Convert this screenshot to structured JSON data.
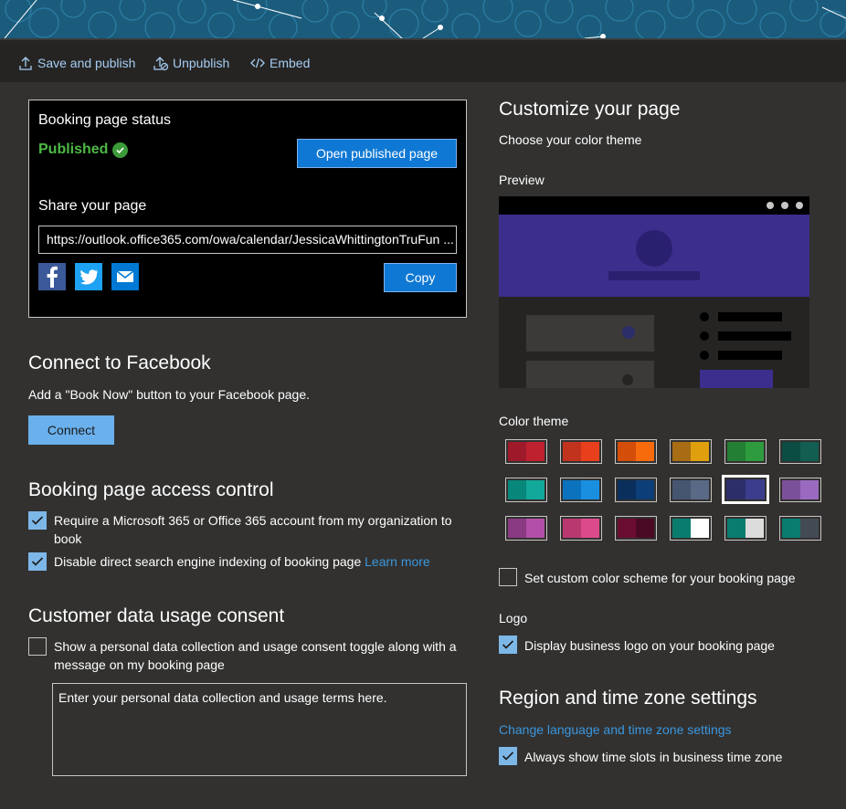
{
  "toolbar": {
    "save": "Save and publish",
    "unpublish": "Unpublish",
    "embed": "Embed"
  },
  "status": {
    "title": "Booking page status",
    "state": "Published",
    "open_button": "Open published page",
    "share_title": "Share your page",
    "url": "https://outlook.office365.com/owa/calendar/JessicaWhittingtonTruFun ...",
    "copy_button": "Copy",
    "social": [
      "facebook-icon",
      "twitter-icon",
      "mail-icon"
    ]
  },
  "facebook": {
    "title": "Connect to Facebook",
    "desc": "Add a \"Book Now\" button to your Facebook page.",
    "button": "Connect"
  },
  "access": {
    "title": "Booking page access control",
    "require_line1": "Require a Microsoft 365 or Office 365 account from my organization to",
    "require_line2": "book",
    "require_checked": true,
    "indexing": "Disable direct search engine indexing of booking page",
    "indexing_checked": true,
    "learn_more": "Learn more"
  },
  "consent": {
    "title": "Customer data usage consent",
    "line1": "Show a personal data collection and usage consent toggle along with a",
    "line2": "message on my booking page",
    "checked": false,
    "placeholder": "Enter your personal data collection and usage terms here."
  },
  "customize": {
    "title": "Customize your page",
    "subtitle": "Choose your color theme",
    "preview_label": "Preview",
    "color_theme_label": "Color theme",
    "accent": "#3b2e8c",
    "swatches": [
      [
        "#9e1a2a",
        "#c0212f"
      ],
      [
        "#c2331d",
        "#e8401c"
      ],
      [
        "#d44e09",
        "#f76b0d"
      ],
      [
        "#a86c14",
        "#e0a00e"
      ],
      [
        "#237f34",
        "#2e9c3e"
      ],
      [
        "#0b4d42",
        "#125e50"
      ],
      [
        "#06877a",
        "#12a89a"
      ],
      [
        "#0b72bd",
        "#1a8fe0"
      ],
      [
        "#0a2f5c",
        "#0c3e78"
      ],
      [
        "#465570",
        "#5a6985"
      ],
      [
        "#2c2e6a",
        "#3b3d8c"
      ],
      [
        "#7b509a",
        "#9a6ac0"
      ],
      [
        "#8a3a83",
        "#b24fa8"
      ],
      [
        "#b8386f",
        "#dd4a8c"
      ],
      [
        "#6b0d30",
        "#4b0a24"
      ],
      [
        "#0a7c6e",
        "#ffffff"
      ],
      [
        "#0a7c6e",
        "#dcdcdc"
      ],
      [
        "#0a7c6e",
        "#444a54"
      ]
    ],
    "selected_swatch": 10,
    "custom_scheme": "Set custom color scheme for your booking page",
    "custom_checked": false
  },
  "logo": {
    "title": "Logo",
    "display": "Display business logo on your booking page",
    "checked": true
  },
  "region": {
    "title": "Region and time zone settings",
    "link": "Change language and time zone settings",
    "always_show": "Always show time slots in business time zone",
    "checked": true
  }
}
